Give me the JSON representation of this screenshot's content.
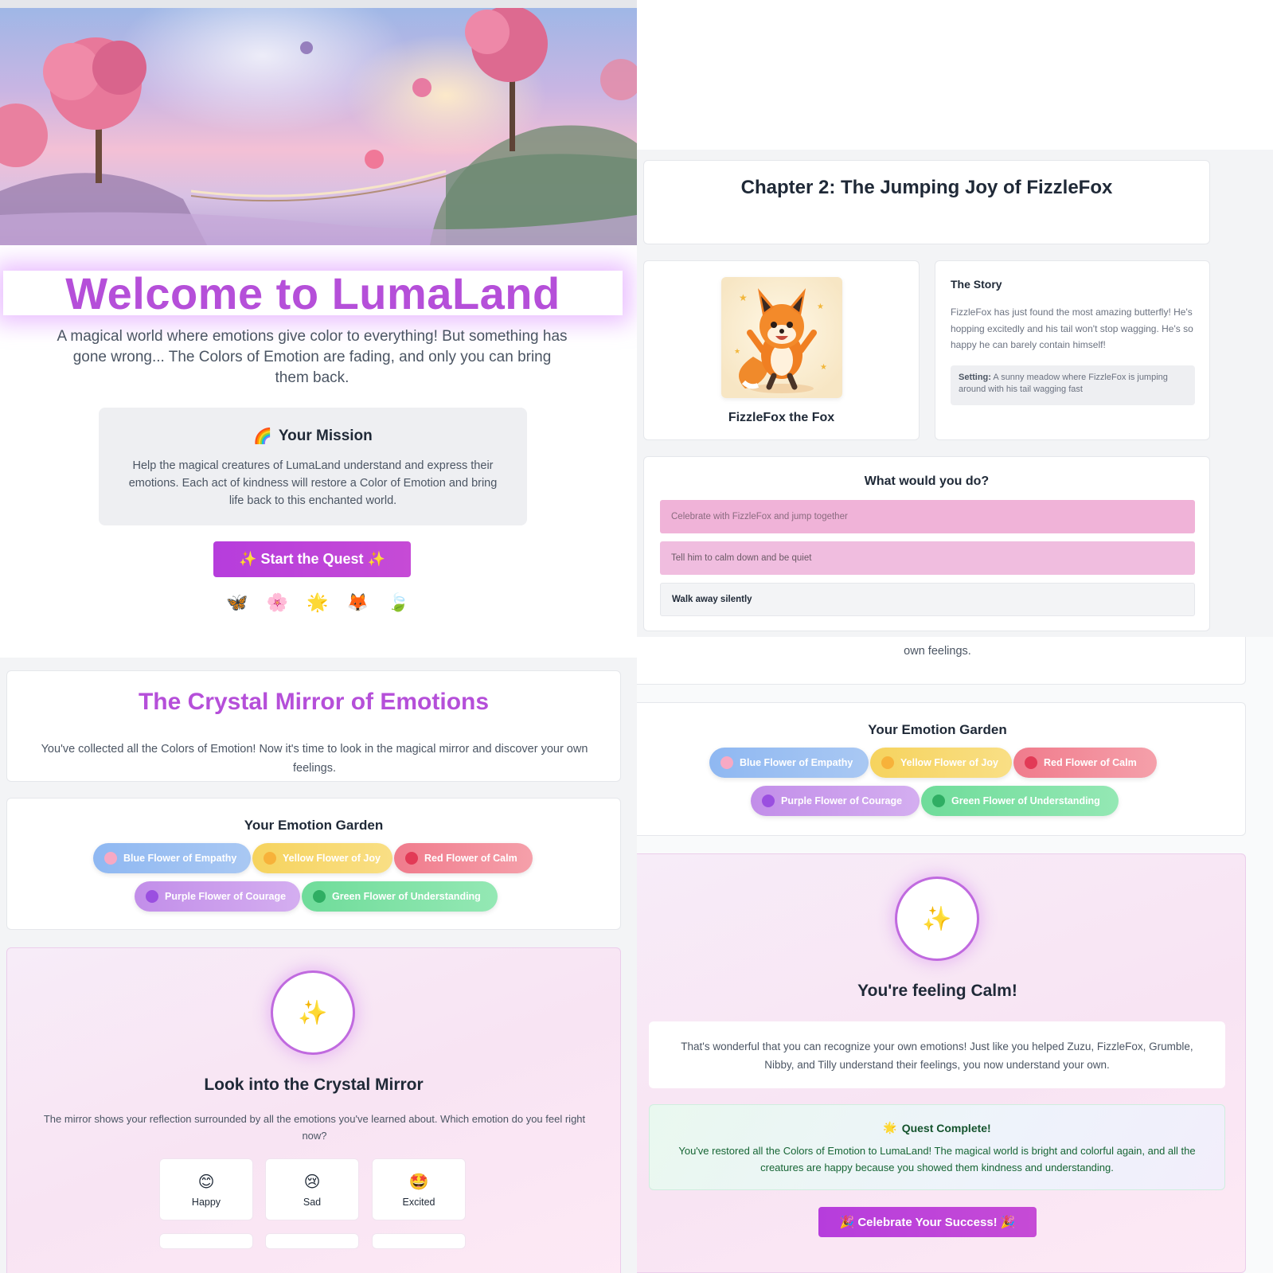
{
  "welcome": {
    "title": "Welcome to LumaLand",
    "intro": "A magical world where emotions give color to everything! But something has gone wrong... The Colors of Emotion are fading, and only you can bring them back.",
    "mission_icon": "🌈",
    "mission_title": "Your Mission",
    "mission_text": "Help the magical creatures of LumaLand understand and express their emotions. Each act of kindness will restore a Color of Emotion and bring life back to this enchanted world.",
    "start_button": "✨ Start the Quest ✨",
    "critters": [
      "🦋",
      "🌸",
      "🌟",
      "🦊",
      "🍃"
    ]
  },
  "chapter": {
    "title": "Chapter 2: The Jumping Joy of FizzleFox",
    "character_name": "FizzleFox the Fox",
    "story_title": "The Story",
    "story_text": "FizzleFox has just found the most amazing butterfly! He's hopping excitedly and his tail won't stop wagging. He's so happy he can barely contain himself!",
    "setting_label": "Setting:",
    "setting_text": "A sunny meadow where FizzleFox is jumping around with his tail wagging fast",
    "question": "What would you do?",
    "choices": [
      "Celebrate with FizzleFox and jump together",
      "Tell him to calm down and be quiet",
      "Walk away silently"
    ]
  },
  "mirror": {
    "title": "The Crystal Mirror of Emotions",
    "subtitle": "You've collected all the Colors of Emotion! Now it's time to look in the magical mirror and discover your own feelings.",
    "garden_title": "Your Emotion Garden",
    "flowers": [
      {
        "label": "Blue Flower of Empathy",
        "icon": "🌸",
        "color": "#8fb8f2"
      },
      {
        "label": "Yellow Flower of Joy",
        "icon": "💛",
        "color": "#f6d35e"
      },
      {
        "label": "Red Flower of Calm",
        "icon": "❤️",
        "color": "#f07b8c"
      },
      {
        "label": "Purple Flower of Courage",
        "icon": "💜",
        "color": "#c28ee9"
      },
      {
        "label": "Green Flower of Understanding",
        "icon": "🟢",
        "color": "#6fdc9a"
      }
    ],
    "orb_icon": "✨",
    "look_title": "Look into the Crystal Mirror",
    "look_text": "The mirror shows your reflection surrounded by all the emotions you've learned about. Which emotion do you feel right now?",
    "emotions": [
      {
        "face": "😊",
        "label": "Happy"
      },
      {
        "face": "😢",
        "label": "Sad"
      },
      {
        "face": "🤩",
        "label": "Excited"
      }
    ]
  },
  "result": {
    "tail_text": "own feelings.",
    "garden_title": "Your Emotion Garden",
    "orb_icon": "✨",
    "calm_title": "You're feeling Calm!",
    "calm_text": "That's wonderful that you can recognize your own emotions! Just like you helped Zuzu, FizzleFox, Grumble, Nibby, and Tilly understand their feelings, you now understand your own.",
    "quest_icon": "🌟",
    "quest_title": "Quest Complete!",
    "quest_text": "You've restored all the Colors of Emotion to LumaLand! The magical world is bright and colorful again, and all the creatures are happy because you showed them kindness and understanding.",
    "celebrate_button": "🎉 Celebrate Your Success! 🎉"
  },
  "colors": {
    "accent_purple": "#b54fd9",
    "button_gradient_start": "#b63ddc",
    "choice_pink": "#f0b3d8"
  }
}
